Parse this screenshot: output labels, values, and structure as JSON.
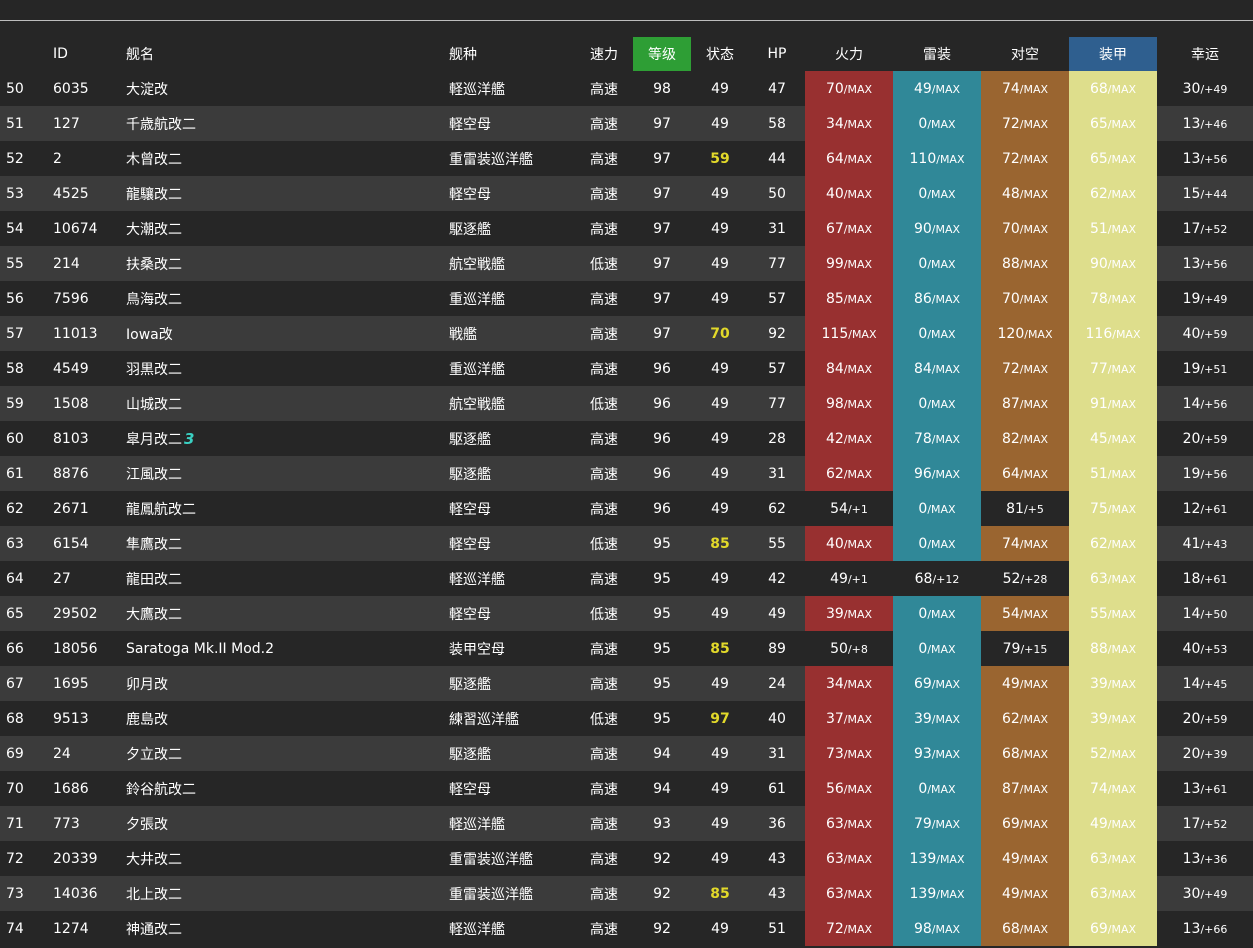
{
  "headers": {
    "no": "",
    "id": "ID",
    "name": "舰名",
    "type": "舰种",
    "speed": "速力",
    "level": "等级",
    "cond": "状态",
    "hp": "HP",
    "firepower": "火力",
    "torpedo": "雷装",
    "antiair": "对空",
    "armor": "装甲",
    "luck": "幸运"
  },
  "colors": {
    "firepower_max": "#983030",
    "torpedo_max": "#308898",
    "antiair_max": "#9a6530",
    "armor_max": "#dede8c",
    "level_header": "#2e9e35",
    "armor_header": "#2f5f8f",
    "highlight_cond": "#e2d92a",
    "marker": "#3ad0c2"
  },
  "rows": [
    {
      "no": "50",
      "id": "6035",
      "name": "大淀改",
      "type": "軽巡洋艦",
      "speed": "高速",
      "level": "98",
      "cond": "49",
      "cond_hl": false,
      "hp": "47",
      "fp": "70",
      "fpm": "/MAX",
      "fpmax": true,
      "tp": "49",
      "tpm": "/MAX",
      "aa": "74",
      "aam": "/MAX",
      "aamax": true,
      "ar": "68",
      "arm": "/MAX",
      "lk": "30",
      "lkm": "/+49"
    },
    {
      "no": "51",
      "id": "127",
      "name": "千歳航改二",
      "type": "軽空母",
      "speed": "高速",
      "level": "97",
      "cond": "49",
      "cond_hl": false,
      "hp": "58",
      "fp": "34",
      "fpm": "/MAX",
      "fpmax": true,
      "tp": "0",
      "tpm": "/MAX",
      "aa": "72",
      "aam": "/MAX",
      "aamax": true,
      "ar": "65",
      "arm": "/MAX",
      "lk": "13",
      "lkm": "/+46"
    },
    {
      "no": "52",
      "id": "2",
      "name": "木曾改二",
      "type": "重雷装巡洋艦",
      "speed": "高速",
      "level": "97",
      "cond": "59",
      "cond_hl": true,
      "hp": "44",
      "fp": "64",
      "fpm": "/MAX",
      "fpmax": true,
      "tp": "110",
      "tpm": "/MAX",
      "aa": "72",
      "aam": "/MAX",
      "aamax": true,
      "ar": "65",
      "arm": "/MAX",
      "lk": "13",
      "lkm": "/+56"
    },
    {
      "no": "53",
      "id": "4525",
      "name": "龍驤改二",
      "type": "軽空母",
      "speed": "高速",
      "level": "97",
      "cond": "49",
      "cond_hl": false,
      "hp": "50",
      "fp": "40",
      "fpm": "/MAX",
      "fpmax": true,
      "tp": "0",
      "tpm": "/MAX",
      "aa": "48",
      "aam": "/MAX",
      "aamax": true,
      "ar": "62",
      "arm": "/MAX",
      "lk": "15",
      "lkm": "/+44"
    },
    {
      "no": "54",
      "id": "10674",
      "name": "大潮改二",
      "type": "駆逐艦",
      "speed": "高速",
      "level": "97",
      "cond": "49",
      "cond_hl": false,
      "hp": "31",
      "fp": "67",
      "fpm": "/MAX",
      "fpmax": true,
      "tp": "90",
      "tpm": "/MAX",
      "aa": "70",
      "aam": "/MAX",
      "aamax": true,
      "ar": "51",
      "arm": "/MAX",
      "lk": "17",
      "lkm": "/+52"
    },
    {
      "no": "55",
      "id": "214",
      "name": "扶桑改二",
      "type": "航空戦艦",
      "speed": "低速",
      "level": "97",
      "cond": "49",
      "cond_hl": false,
      "hp": "77",
      "fp": "99",
      "fpm": "/MAX",
      "fpmax": true,
      "tp": "0",
      "tpm": "/MAX",
      "aa": "88",
      "aam": "/MAX",
      "aamax": true,
      "ar": "90",
      "arm": "/MAX",
      "lk": "13",
      "lkm": "/+56"
    },
    {
      "no": "56",
      "id": "7596",
      "name": "鳥海改二",
      "type": "重巡洋艦",
      "speed": "高速",
      "level": "97",
      "cond": "49",
      "cond_hl": false,
      "hp": "57",
      "fp": "85",
      "fpm": "/MAX",
      "fpmax": true,
      "tp": "86",
      "tpm": "/MAX",
      "aa": "70",
      "aam": "/MAX",
      "aamax": true,
      "ar": "78",
      "arm": "/MAX",
      "lk": "19",
      "lkm": "/+49"
    },
    {
      "no": "57",
      "id": "11013",
      "name": "Iowa改",
      "type": "戦艦",
      "speed": "高速",
      "level": "97",
      "cond": "70",
      "cond_hl": true,
      "hp": "92",
      "fp": "115",
      "fpm": "/MAX",
      "fpmax": true,
      "tp": "0",
      "tpm": "/MAX",
      "aa": "120",
      "aam": "/MAX",
      "aamax": true,
      "ar": "116",
      "arm": "/MAX",
      "lk": "40",
      "lkm": "/+59"
    },
    {
      "no": "58",
      "id": "4549",
      "name": "羽黒改二",
      "type": "重巡洋艦",
      "speed": "高速",
      "level": "96",
      "cond": "49",
      "cond_hl": false,
      "hp": "57",
      "fp": "84",
      "fpm": "/MAX",
      "fpmax": true,
      "tp": "84",
      "tpm": "/MAX",
      "aa": "72",
      "aam": "/MAX",
      "aamax": true,
      "ar": "77",
      "arm": "/MAX",
      "lk": "19",
      "lkm": "/+51"
    },
    {
      "no": "59",
      "id": "1508",
      "name": "山城改二",
      "type": "航空戦艦",
      "speed": "低速",
      "level": "96",
      "cond": "49",
      "cond_hl": false,
      "hp": "77",
      "fp": "98",
      "fpm": "/MAX",
      "fpmax": true,
      "tp": "0",
      "tpm": "/MAX",
      "aa": "87",
      "aam": "/MAX",
      "aamax": true,
      "ar": "91",
      "arm": "/MAX",
      "lk": "14",
      "lkm": "/+56"
    },
    {
      "no": "60",
      "id": "8103",
      "name": "皐月改二",
      "mark": "3",
      "type": "駆逐艦",
      "speed": "高速",
      "level": "96",
      "cond": "49",
      "cond_hl": false,
      "hp": "28",
      "fp": "42",
      "fpm": "/MAX",
      "fpmax": true,
      "tp": "78",
      "tpm": "/MAX",
      "aa": "82",
      "aam": "/MAX",
      "aamax": true,
      "ar": "45",
      "arm": "/MAX",
      "lk": "20",
      "lkm": "/+59"
    },
    {
      "no": "61",
      "id": "8876",
      "name": "江風改二",
      "type": "駆逐艦",
      "speed": "高速",
      "level": "96",
      "cond": "49",
      "cond_hl": false,
      "hp": "31",
      "fp": "62",
      "fpm": "/MAX",
      "fpmax": true,
      "tp": "96",
      "tpm": "/MAX",
      "aa": "64",
      "aam": "/MAX",
      "aamax": true,
      "ar": "51",
      "arm": "/MAX",
      "lk": "19",
      "lkm": "/+56"
    },
    {
      "no": "62",
      "id": "2671",
      "name": "龍鳳航改二",
      "type": "軽空母",
      "speed": "高速",
      "level": "96",
      "cond": "49",
      "cond_hl": false,
      "hp": "62",
      "fp": "54",
      "fpm": "/+1",
      "fpmax": false,
      "tp": "0",
      "tpm": "/MAX",
      "aa": "81",
      "aam": "/+5",
      "aamax": false,
      "ar": "75",
      "arm": "/MAX",
      "lk": "12",
      "lkm": "/+61"
    },
    {
      "no": "63",
      "id": "6154",
      "name": "隼鷹改二",
      "type": "軽空母",
      "speed": "低速",
      "level": "95",
      "cond": "85",
      "cond_hl": true,
      "hp": "55",
      "fp": "40",
      "fpm": "/MAX",
      "fpmax": true,
      "tp": "0",
      "tpm": "/MAX",
      "aa": "74",
      "aam": "/MAX",
      "aamax": true,
      "ar": "62",
      "arm": "/MAX",
      "lk": "41",
      "lkm": "/+43"
    },
    {
      "no": "64",
      "id": "27",
      "name": "龍田改二",
      "type": "軽巡洋艦",
      "speed": "高速",
      "level": "95",
      "cond": "49",
      "cond_hl": false,
      "hp": "42",
      "fp": "49",
      "fpm": "/+1",
      "fpmax": false,
      "tp": "68",
      "tpm": "/+12",
      "tpmax": false,
      "aa": "52",
      "aam": "/+28",
      "aamax": false,
      "ar": "63",
      "arm": "/MAX",
      "lk": "18",
      "lkm": "/+61"
    },
    {
      "no": "65",
      "id": "29502",
      "name": "大鷹改二",
      "type": "軽空母",
      "speed": "低速",
      "level": "95",
      "cond": "49",
      "cond_hl": false,
      "hp": "49",
      "fp": "39",
      "fpm": "/MAX",
      "fpmax": true,
      "tp": "0",
      "tpm": "/MAX",
      "aa": "54",
      "aam": "/MAX",
      "aamax": true,
      "ar": "55",
      "arm": "/MAX",
      "lk": "14",
      "lkm": "/+50"
    },
    {
      "no": "66",
      "id": "18056",
      "name": "Saratoga Mk.II Mod.2",
      "type": "装甲空母",
      "speed": "高速",
      "level": "95",
      "cond": "85",
      "cond_hl": true,
      "hp": "89",
      "fp": "50",
      "fpm": "/+8",
      "fpmax": false,
      "tp": "0",
      "tpm": "/MAX",
      "aa": "79",
      "aam": "/+15",
      "aamax": false,
      "ar": "88",
      "arm": "/MAX",
      "lk": "40",
      "lkm": "/+53"
    },
    {
      "no": "67",
      "id": "1695",
      "name": "卯月改",
      "type": "駆逐艦",
      "speed": "高速",
      "level": "95",
      "cond": "49",
      "cond_hl": false,
      "hp": "24",
      "fp": "34",
      "fpm": "/MAX",
      "fpmax": true,
      "tp": "69",
      "tpm": "/MAX",
      "aa": "49",
      "aam": "/MAX",
      "aamax": true,
      "ar": "39",
      "arm": "/MAX",
      "lk": "14",
      "lkm": "/+45"
    },
    {
      "no": "68",
      "id": "9513",
      "name": "鹿島改",
      "type": "練習巡洋艦",
      "speed": "低速",
      "level": "95",
      "cond": "97",
      "cond_hl": true,
      "hp": "40",
      "fp": "37",
      "fpm": "/MAX",
      "fpmax": true,
      "tp": "39",
      "tpm": "/MAX",
      "aa": "62",
      "aam": "/MAX",
      "aamax": true,
      "ar": "39",
      "arm": "/MAX",
      "lk": "20",
      "lkm": "/+59"
    },
    {
      "no": "69",
      "id": "24",
      "name": "夕立改二",
      "type": "駆逐艦",
      "speed": "高速",
      "level": "94",
      "cond": "49",
      "cond_hl": false,
      "hp": "31",
      "fp": "73",
      "fpm": "/MAX",
      "fpmax": true,
      "tp": "93",
      "tpm": "/MAX",
      "aa": "68",
      "aam": "/MAX",
      "aamax": true,
      "ar": "52",
      "arm": "/MAX",
      "lk": "20",
      "lkm": "/+39"
    },
    {
      "no": "70",
      "id": "1686",
      "name": "鈴谷航改二",
      "type": "軽空母",
      "speed": "高速",
      "level": "94",
      "cond": "49",
      "cond_hl": false,
      "hp": "61",
      "fp": "56",
      "fpm": "/MAX",
      "fpmax": true,
      "tp": "0",
      "tpm": "/MAX",
      "aa": "87",
      "aam": "/MAX",
      "aamax": true,
      "ar": "74",
      "arm": "/MAX",
      "lk": "13",
      "lkm": "/+61"
    },
    {
      "no": "71",
      "id": "773",
      "name": "夕張改",
      "type": "軽巡洋艦",
      "speed": "高速",
      "level": "93",
      "cond": "49",
      "cond_hl": false,
      "hp": "36",
      "fp": "63",
      "fpm": "/MAX",
      "fpmax": true,
      "tp": "79",
      "tpm": "/MAX",
      "aa": "69",
      "aam": "/MAX",
      "aamax": true,
      "ar": "49",
      "arm": "/MAX",
      "lk": "17",
      "lkm": "/+52"
    },
    {
      "no": "72",
      "id": "20339",
      "name": "大井改二",
      "type": "重雷装巡洋艦",
      "speed": "高速",
      "level": "92",
      "cond": "49",
      "cond_hl": false,
      "hp": "43",
      "fp": "63",
      "fpm": "/MAX",
      "fpmax": true,
      "tp": "139",
      "tpm": "/MAX",
      "aa": "49",
      "aam": "/MAX",
      "aamax": true,
      "ar": "63",
      "arm": "/MAX",
      "lk": "13",
      "lkm": "/+36"
    },
    {
      "no": "73",
      "id": "14036",
      "name": "北上改二",
      "type": "重雷装巡洋艦",
      "speed": "高速",
      "level": "92",
      "cond": "85",
      "cond_hl": true,
      "hp": "43",
      "fp": "63",
      "fpm": "/MAX",
      "fpmax": true,
      "tp": "139",
      "tpm": "/MAX",
      "aa": "49",
      "aam": "/MAX",
      "aamax": true,
      "ar": "63",
      "arm": "/MAX",
      "lk": "30",
      "lkm": "/+49"
    },
    {
      "no": "74",
      "id": "1274",
      "name": "神通改二",
      "type": "軽巡洋艦",
      "speed": "高速",
      "level": "92",
      "cond": "49",
      "cond_hl": false,
      "hp": "51",
      "fp": "72",
      "fpm": "/MAX",
      "fpmax": true,
      "tp": "98",
      "tpm": "/MAX",
      "aa": "68",
      "aam": "/MAX",
      "aamax": true,
      "ar": "69",
      "arm": "/MAX",
      "lk": "13",
      "lkm": "/+66"
    }
  ]
}
